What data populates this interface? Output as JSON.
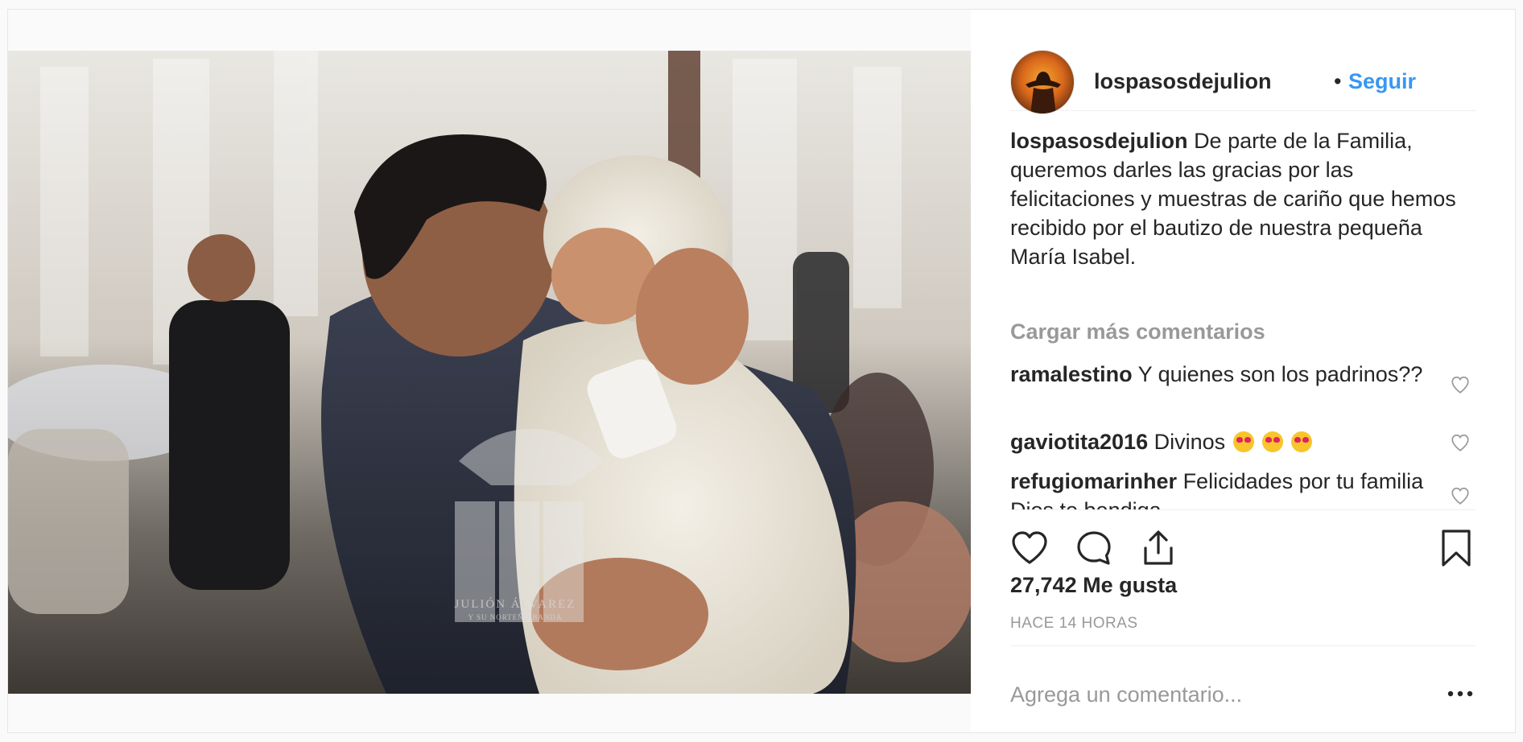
{
  "post": {
    "header": {
      "username": "lospasosdejulion",
      "separator": "•",
      "follow_label": "Seguir"
    },
    "caption": {
      "username": "lospasosdejulion",
      "text": "De parte de la Familia, queremos darles las gracias por las felicitaciones y muestras de cariño que hemos recibido por el bautizo de nuestra pequeña María Isabel."
    },
    "load_more_label": "Cargar más comentarios",
    "comments": [
      {
        "username": "ramalestino",
        "text": "Y quienes son los padrinos??"
      },
      {
        "username": "gaviotita2016",
        "text": "Divinos",
        "emoji": [
          "heart-eyes",
          "heart-eyes",
          "heart-eyes"
        ]
      },
      {
        "username": "refugiomarinher",
        "text": "Felicidades por tu familia Dios te bendiga"
      }
    ],
    "likes": "27,742 Me gusta",
    "timestamp": "HACE 14 HORAS",
    "add_comment_placeholder": "Agrega un comentario...",
    "watermark": {
      "line1": "JULIÓN ÁLVAREZ",
      "line2": "Y SU NORTEÑO BANDA"
    },
    "colors": {
      "link_blue": "#3897f0",
      "text": "#262626",
      "muted": "#999999",
      "border": "#efefef"
    },
    "icons": [
      "heart-icon",
      "comment-icon",
      "share-icon",
      "bookmark-icon",
      "more-options-icon"
    ]
  }
}
